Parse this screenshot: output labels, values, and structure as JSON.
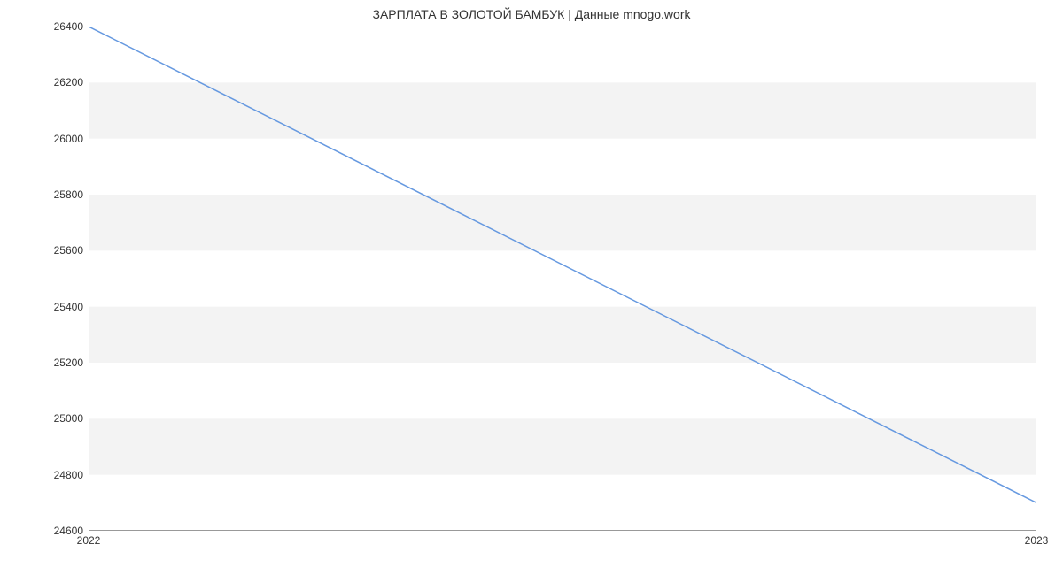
{
  "chart_data": {
    "type": "line",
    "title": "ЗАРПЛАТА В  ЗОЛОТОЙ БАМБУК | Данные mnogo.work",
    "x": [
      2022,
      2023
    ],
    "values": [
      26400,
      24700
    ],
    "xlabel": "",
    "ylabel": "",
    "xlim": [
      2022,
      2023
    ],
    "ylim": [
      24600,
      26400
    ],
    "x_ticks": [
      2022,
      2023
    ],
    "y_ticks": [
      24600,
      24800,
      25000,
      25200,
      25400,
      25600,
      25800,
      26000,
      26200,
      26400
    ],
    "line_color": "#6699e0",
    "band_color": "#f3f3f3",
    "axis_color": "#333333"
  }
}
